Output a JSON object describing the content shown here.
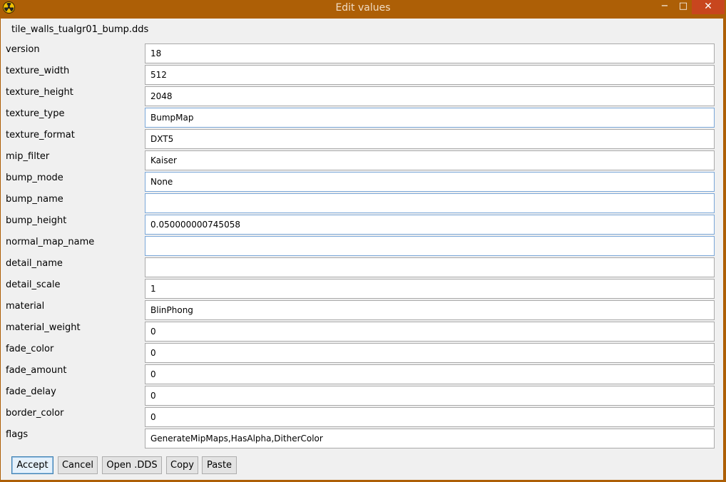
{
  "window": {
    "title": "Edit values",
    "minimize_glyph": "−",
    "maximize_glyph": "□",
    "close_glyph": "✕"
  },
  "filename": "tile_walls_tualgr01_bump.dds",
  "fields": [
    {
      "label": "version",
      "value": "18"
    },
    {
      "label": "texture_width",
      "value": "512"
    },
    {
      "label": "texture_height",
      "value": "2048"
    },
    {
      "label": "texture_type",
      "value": "BumpMap"
    },
    {
      "label": "texture_format",
      "value": "DXT5"
    },
    {
      "label": "mip_filter",
      "value": "Kaiser"
    },
    {
      "label": "bump_mode",
      "value": "None"
    },
    {
      "label": "bump_name",
      "value": ""
    },
    {
      "label": "bump_height",
      "value": "0.050000000745058"
    },
    {
      "label": "normal_map_name",
      "value": ""
    },
    {
      "label": "detail_name",
      "value": ""
    },
    {
      "label": "detail_scale",
      "value": "1"
    },
    {
      "label": "material",
      "value": "BlinPhong"
    },
    {
      "label": "material_weight",
      "value": "0"
    },
    {
      "label": "fade_color",
      "value": "0"
    },
    {
      "label": "fade_amount",
      "value": "0"
    },
    {
      "label": "fade_delay",
      "value": "0"
    },
    {
      "label": "border_color",
      "value": "0"
    },
    {
      "label": "flags",
      "value": "GenerateMipMaps,HasAlpha,DitherColor"
    }
  ],
  "buttons": {
    "accept": "Accept",
    "cancel": "Cancel",
    "open_dds": "Open .DDS",
    "copy": "Copy",
    "paste": "Paste"
  },
  "colors": {
    "titlebar": "#ad5f06",
    "close_button": "#c8461e",
    "client_background": "#f0f0f0",
    "focus_border": "#7aa7d8"
  },
  "icons": {
    "app": "radiation-icon"
  }
}
